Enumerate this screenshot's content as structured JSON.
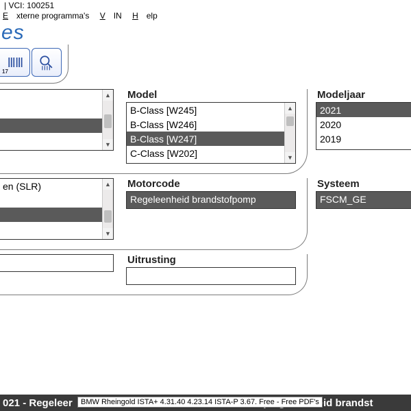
{
  "status_line": " | VCI: 100251",
  "menu": {
    "externe": "Externe programma's",
    "vin": "VIN",
    "help": "Help"
  },
  "brand_fragment": "es",
  "toolbar": {
    "btn1_num": "17"
  },
  "labels": {
    "model": "Model",
    "modeljaar": "Modeljaar",
    "motorcode": "Motorcode",
    "systeem": "Systeem",
    "uitrusting": "Uitrusting"
  },
  "left_ghost_list": {
    "items": [
      {
        "text": "",
        "star": true,
        "sel": false
      },
      {
        "text": "",
        "star": true,
        "sel": false
      },
      {
        "text": "",
        "star": true,
        "sel": true
      },
      {
        "text": "",
        "star": false,
        "sel": false
      }
    ]
  },
  "model_list": {
    "items": [
      {
        "text": "B-Class [W245]",
        "star": false,
        "sel": false
      },
      {
        "text": "B-Class [W246]",
        "star": true,
        "sel": false
      },
      {
        "text": "B-Class [W247]",
        "star": true,
        "sel": true
      },
      {
        "text": "C-Class [W202]",
        "star": false,
        "sel": false
      }
    ]
  },
  "year_list": {
    "items": [
      {
        "text": "2021",
        "sel": true
      },
      {
        "text": "2020",
        "sel": false
      },
      {
        "text": "2019",
        "sel": false
      }
    ]
  },
  "left_ghost_list2": {
    "items": [
      {
        "text": "en (SLR)",
        "star": true,
        "sel": false
      },
      {
        "text": "",
        "star": true,
        "sel": false
      },
      {
        "text": "",
        "star": true,
        "sel": true
      },
      {
        "text": "",
        "star": false,
        "sel": false
      }
    ]
  },
  "motorcode_value": "Regeleenheid brandstofpomp",
  "systeem_value": "FSCM_GE",
  "uitrusting_value": "",
  "footer_left": "021 - Regeleer",
  "footer_right": "GEN5 (Regeleenheid brandst",
  "tooltip_text": "BMW Rheingold ISTA+ 4.31.40 4.23.14 ISTA-P 3.67. Free - Free PDF's"
}
